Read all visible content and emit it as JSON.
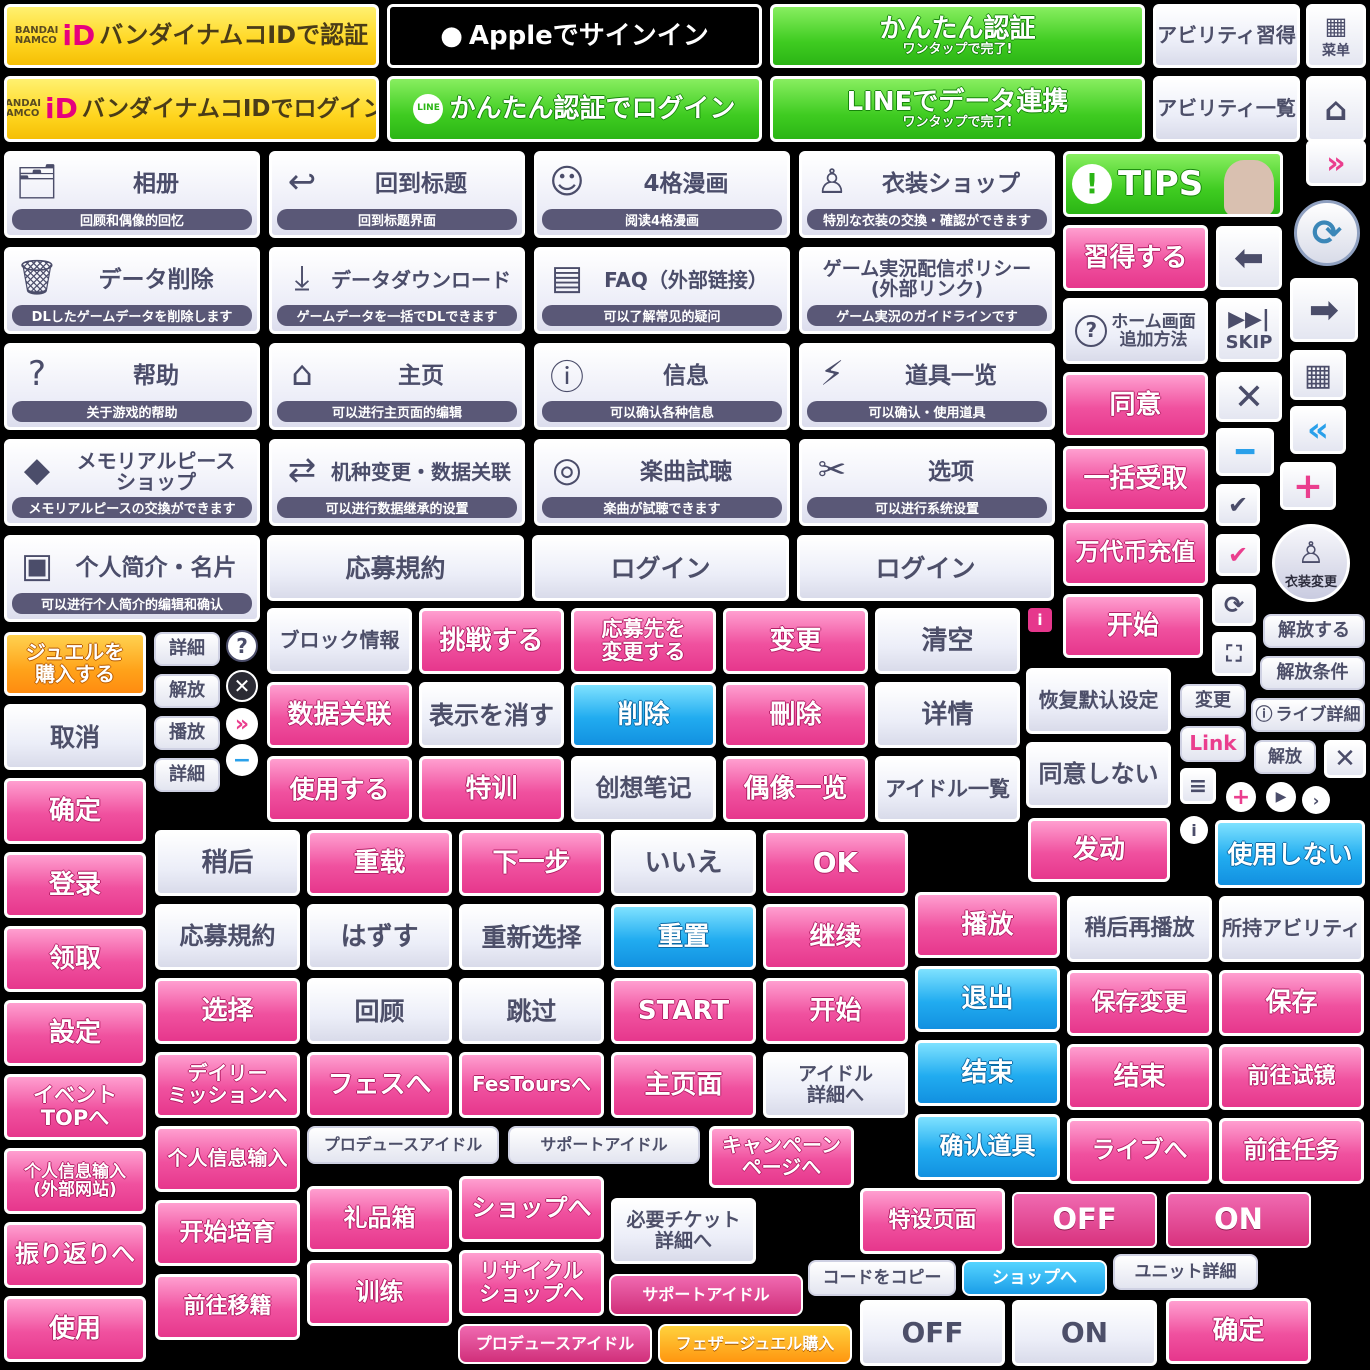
{
  "row1": {
    "bandai_auth": "バンダイナムコIDで認証",
    "bandai_logo_1": "BANDAI",
    "bandai_logo_2": "NAMCO",
    "bandai_logo_id": "iD",
    "apple_signin": "Appleでサインイン",
    "line_easy_auth": "かんたん認証",
    "line_easy_auth_sub": "ワンタップで完了!",
    "line_icon": "LINE",
    "ability_learn": "アビリティ習得",
    "menu": "菜单"
  },
  "row2": {
    "bandai_login": "バンダイナムコIDでログイン",
    "easy_auth_login": "かんたん認証でログイン",
    "line_data_link": "LINEでデータ連携",
    "line_data_link_sub": "ワンタップで完了!",
    "ability_list": "アビリティ一覧"
  },
  "cards": [
    {
      "icon": "album-icon",
      "title": "相册",
      "sub": "回顾和偶像的回忆"
    },
    {
      "icon": "back-arrow-icon",
      "title": "回到标题",
      "sub": "回到标题界面"
    },
    {
      "icon": "manga-face-icon",
      "title": "4格漫画",
      "sub": "阅读4格漫画"
    },
    {
      "icon": "mannequin-icon",
      "title": "衣装ショップ",
      "sub": "特別な衣装の交換・確認ができます"
    },
    {
      "icon": "trash-icon",
      "title": "データ削除",
      "sub": "DLしたゲームデータを削除します"
    },
    {
      "icon": "download-icon",
      "title": "データダウンロード",
      "sub": "ゲームデータを一括でDLできます"
    },
    {
      "icon": "document-icon",
      "title": "FAQ（外部链接）",
      "sub": "可以了解常见的疑问"
    },
    {
      "icon": "none",
      "title": "ゲーム実況配信ポリシー\n(外部リンク)",
      "sub": "ゲーム実況のガイドラインです"
    },
    {
      "icon": "question-icon",
      "title": "帮助",
      "sub": "关于游戏的帮助"
    },
    {
      "icon": "house-icon",
      "title": "主页",
      "sub": "可以进行主页面的编辑"
    },
    {
      "icon": "info-icon",
      "title": "信息",
      "sub": "可以确认各种信息"
    },
    {
      "icon": "drink-icon",
      "title": "道具一览",
      "sub": "可以确认・使用道具"
    },
    {
      "icon": "gem-icon",
      "title": "メモリアルピース\nショップ",
      "sub": "メモリアルピースの交換ができます"
    },
    {
      "icon": "device-transfer-icon",
      "title": "机种变更・数据关联",
      "sub": "可以进行数据继承的设置"
    },
    {
      "icon": "cd-icon",
      "title": "楽曲試聴",
      "sub": "楽曲が試聴できます"
    },
    {
      "icon": "wrench-icon",
      "title": "选项",
      "sub": "可以进行系统设置"
    },
    {
      "icon": "profile-card-icon",
      "title": "个人简介・名片",
      "sub": "可以进行个人简介的编辑和确认"
    }
  ],
  "wide": {
    "apply_terms": "応募規約",
    "login": "ログイン"
  },
  "tips": {
    "label": "TIPS"
  },
  "right_col": {
    "learn": "習得する",
    "home_add": "ホーム画面\n追加方法",
    "skip": "SKIP",
    "agree": "同意",
    "bulk_receive": "一括受取",
    "coin_charge": "万代币充值",
    "start_cn": "开始",
    "costume_change": "衣装変更"
  },
  "jewel": {
    "buy": "ジュエルを\n購入する"
  },
  "small_left": [
    "詳細",
    "解放",
    "播放",
    "詳細"
  ],
  "grid_top": {
    "block_info": "ブロック情報",
    "challenge": "挑戦する",
    "apply_change": "応募先を\n変更する",
    "change": "变更",
    "clear": "清空",
    "data_link": "数据关联",
    "hide": "表示を消す",
    "delete_jp": "削除",
    "delete_tw": "刪除",
    "detail": "详情",
    "use": "使用する",
    "special": "特训",
    "notes": "创想笔记",
    "idol_list_cn": "偶像一览",
    "idol_list_jp": "アイドル一覧"
  },
  "right_mid": {
    "restore_default": "恢复默认设定",
    "change_jp": "変更",
    "link": "Link",
    "agree_not": "同意しない",
    "unlock": "解放する",
    "unlock_cond": "解放条件",
    "live_detail": "ライブ詳細",
    "unlock_small": "解放",
    "activate": "发动",
    "not_use": "使用しない"
  },
  "left_col": {
    "cancel": "取消",
    "confirm": "确定",
    "register": "登录",
    "receive": "领取",
    "settings": "設定",
    "event_top": "イベント\nTOPへ",
    "personal_ext": "个人信息输入\n(外部网站)",
    "review": "振り返りへ",
    "use": "使用"
  },
  "grid": {
    "later": "稍后",
    "reload": "重载",
    "next": "下一步",
    "no": "いいえ",
    "ok": "OK",
    "apply_terms": "応募規約",
    "remove": "はずす",
    "reselect": "重新选择",
    "reset": "重置",
    "continue": "继续",
    "select": "选择",
    "recall": "回顾",
    "skip": "跳过",
    "start": "START",
    "start_cn": "开始",
    "daily_mission": "デイリー\nミッションへ",
    "fes": "フェスへ",
    "fes_tours": "FesToursへ",
    "home_page": "主页面",
    "idol_detail": "アイドル\n詳細へ",
    "personal_input": "个人信息输入",
    "produce_idol": "プロデュースアイドル",
    "support_idol": "サポートアイドル",
    "campaign": "キャンペーン\nページへ",
    "start_training": "开始培育",
    "gift_box": "礼品箱",
    "shop": "ショップへ",
    "need_ticket": "必要チケット\n詳細へ",
    "go_transfer": "前往移籍",
    "training": "训练",
    "recycle_shop": "リサイクル\nショップへ",
    "support_idol_pink": "サポートアイドル",
    "produce_idol_pink": "プロデュースアイドル",
    "feather_jewel": "フェザージュエル購入"
  },
  "right_grid": {
    "play": "播放",
    "play_later": "稍后再播放",
    "owned_ability": "所持アビリティ",
    "exit": "退出",
    "save_change": "保存変更",
    "save": "保存",
    "end_blue": "结束",
    "end_pink": "结束",
    "go_trial": "前往试镜",
    "confirm_item": "确认道具",
    "live": "ライブへ",
    "go_task": "前往任务",
    "special_page": "特设页面",
    "off_pink": "OFF",
    "on_pink": "ON",
    "copy_code": "コードをコピー",
    "shop_blue": "ショップへ",
    "unit_detail": "ユニット詳細",
    "off_white": "OFF",
    "on_white": "ON",
    "confirm_pink": "确定"
  }
}
